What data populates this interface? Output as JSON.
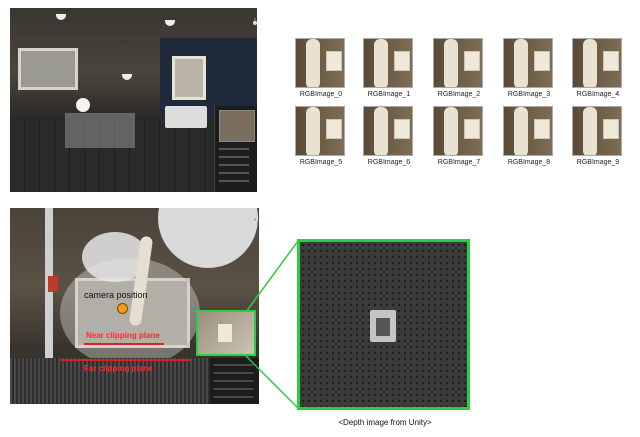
{
  "rgb_images": {
    "labels": [
      "RGBImage_0",
      "RGBImage_1",
      "RGBImage_2",
      "RGBImage_3",
      "RGBImage_4",
      "RGBImage_5",
      "RGBImage_6",
      "RGBImage_7",
      "RGBImage_8",
      "RGBImage_9"
    ]
  },
  "bottom_scene": {
    "camera_label": "camera position",
    "near_label": "Near clipping plane",
    "far_label": "Far clipping plane"
  },
  "depth": {
    "caption": "<Depth image from Unity>"
  },
  "colors": {
    "highlight": "#2ecc40",
    "clip_plane": "#e02020",
    "camera_marker": "#f39c12"
  }
}
